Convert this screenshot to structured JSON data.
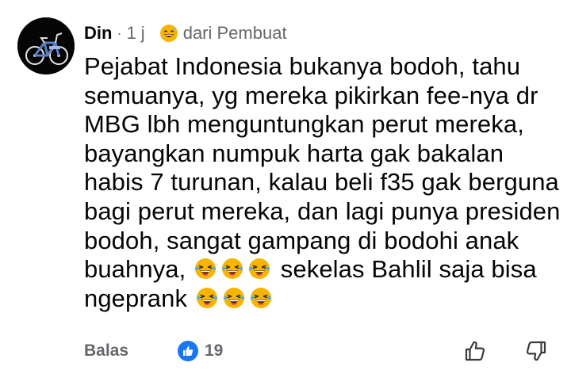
{
  "comment": {
    "author": "Din",
    "separator": "·",
    "time": "1 j",
    "badge_icon": "grinning-sweat-emoji",
    "badge_label": "dari Pembuat",
    "lines": [
      "Pejabat Indonesia bukanya bodoh, tahu",
      "semuanya, yg mereka pikirkan fee-nya dr",
      "MBG lbh menguntungkan perut mereka,",
      "bayangkan numpuk harta gak bakalan",
      "habis 7 turunan, kalau beli f35 gak berguna",
      "bagi perut mereka, dan lagi punya presiden",
      "bodoh, sangat gampang di bodohi anak"
    ],
    "line8_prefix": "buahnya, ",
    "line8_suffix": " sekelas Bahlil saja bisa",
    "line9_prefix": "ngeprank ",
    "emoji_name": "laughing-tears-emoji",
    "colors": {
      "author": "#050505",
      "meta": "#65676b",
      "like_badge": "#1877f2",
      "emoji_face": "#f7b500"
    }
  },
  "actions": {
    "reply_label": "Balas",
    "reaction_icon": "thumbs-up-icon",
    "reaction_count": "19",
    "upvote_icon": "thumbs-up-outline-icon",
    "downvote_icon": "thumbs-down-outline-icon"
  }
}
